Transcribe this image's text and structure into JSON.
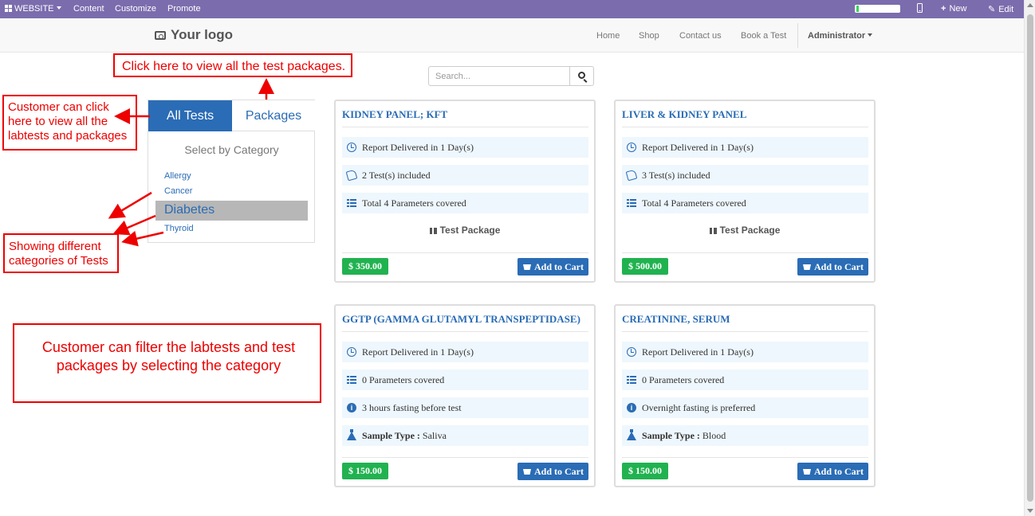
{
  "adminbar": {
    "website_label": "WEBSITE",
    "content_label": "Content",
    "customize_label": "Customize",
    "promote_label": "Promote",
    "new_label": "New",
    "edit_label": "Edit"
  },
  "header": {
    "logo_text": "Your logo",
    "nav": [
      "Home",
      "Shop",
      "Contact us",
      "Book a Test"
    ],
    "user_label": "Administrator"
  },
  "search": {
    "placeholder": "Search..."
  },
  "category_panel": {
    "tab_all": "All Tests",
    "tab_packages": "Packages",
    "title": "Select by Category",
    "categories": [
      "Allergy",
      "Cancer",
      "Diabetes",
      "Thyroid"
    ],
    "active_category": "Diabetes"
  },
  "products": [
    {
      "title": "KIDNEY PANEL; KFT",
      "rows": [
        {
          "icon": "clock-icon",
          "text": "Report Delivered in 1 Day(s)"
        },
        {
          "icon": "thumbs-up-icon",
          "text": "2 Test(s) included"
        },
        {
          "icon": "list-icon",
          "text": "Total 4 Parameters covered"
        }
      ],
      "badge": "Test Package",
      "price": "$ 350.00",
      "cart_label": "Add to Cart"
    },
    {
      "title": "LIVER & KIDNEY PANEL",
      "rows": [
        {
          "icon": "clock-icon",
          "text": "Report Delivered in 1 Day(s)"
        },
        {
          "icon": "thumbs-up-icon",
          "text": "3 Test(s) included"
        },
        {
          "icon": "list-icon",
          "text": "Total 4 Parameters covered"
        }
      ],
      "badge": "Test Package",
      "price": "$ 500.00",
      "cart_label": "Add to Cart"
    },
    {
      "title": "GGTP (GAMMA GLUTAMYL TRANSPEPTIDASE)",
      "rows": [
        {
          "icon": "clock-icon",
          "text": "Report Delivered in 1 Day(s)"
        },
        {
          "icon": "list-icon",
          "text": "0 Parameters covered"
        },
        {
          "icon": "info-icon",
          "text": "3 hours fasting before test"
        },
        {
          "icon": "flask-icon",
          "label": "Sample Type :",
          "text": "Saliva"
        }
      ],
      "price": "$ 150.00",
      "cart_label": "Add to Cart"
    },
    {
      "title": "CREATININE, SERUM",
      "rows": [
        {
          "icon": "clock-icon",
          "text": "Report Delivered in 1 Day(s)"
        },
        {
          "icon": "list-icon",
          "text": "0 Parameters covered"
        },
        {
          "icon": "info-icon",
          "text": "Overnight fasting is preferred"
        },
        {
          "icon": "flask-icon",
          "label": "Sample Type :",
          "text": "Blood"
        }
      ],
      "price": "$ 150.00",
      "cart_label": "Add to Cart"
    }
  ],
  "annotations": {
    "packages_note": "Click here to view all the test packages.",
    "all_tests_note": "Customer can click here to view all the labtests and packages",
    "categories_note": "Showing different categories of Tests",
    "filter_note": "Customer can filter the labtests and test packages by selecting the category"
  },
  "colors": {
    "adminbar": "#7b6cad",
    "primary": "#2a6cb5",
    "price": "#21b250",
    "annotation": "#ee0000"
  }
}
